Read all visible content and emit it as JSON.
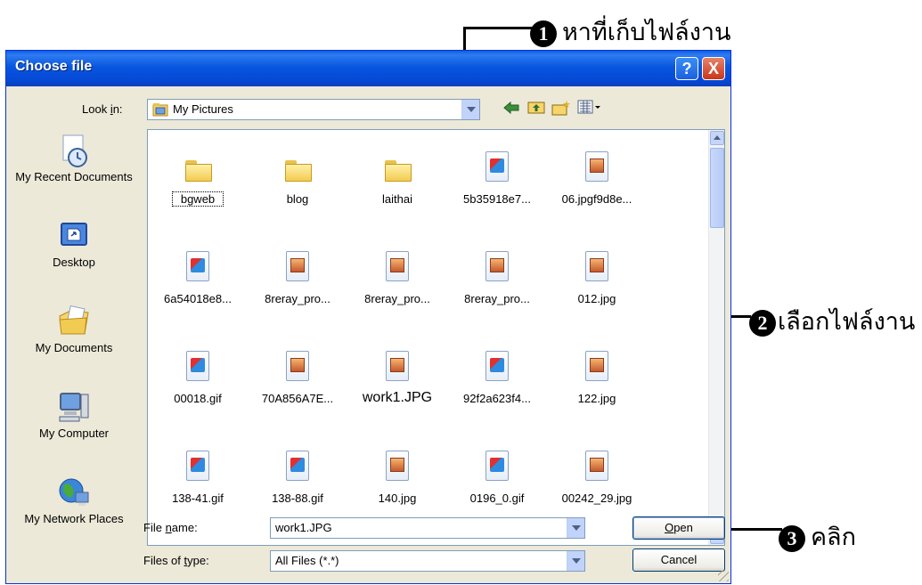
{
  "annotations": {
    "step1": {
      "number": "1",
      "text": "หาที่เก็บไฟล์งาน"
    },
    "step2": {
      "number": "2",
      "text": "เลือกไฟล์งาน"
    },
    "step3": {
      "number": "3",
      "text": "คลิก"
    }
  },
  "dialog": {
    "title": "Choose file",
    "help_icon": "?",
    "close_icon": "X",
    "look_in": {
      "label_pre": "Look ",
      "label_u": "i",
      "label_post": "n:",
      "value": "My Pictures"
    },
    "toolbar_icons": [
      "back-arrow-icon",
      "up-folder-icon",
      "new-folder-icon",
      "view-menu-icon"
    ],
    "places": [
      {
        "label": "My Recent Documents",
        "icon": "recent-documents-icon"
      },
      {
        "label": "Desktop",
        "icon": "desktop-icon"
      },
      {
        "label": "My Documents",
        "icon": "my-documents-icon"
      },
      {
        "label": "My Computer",
        "icon": "my-computer-icon"
      },
      {
        "label": "My Network Places",
        "icon": "network-places-icon"
      }
    ],
    "files": [
      {
        "name": "bgweb",
        "type": "folder"
      },
      {
        "name": "blog",
        "type": "folder"
      },
      {
        "name": "laithai",
        "type": "folder"
      },
      {
        "name": "5b35918e7...",
        "type": "gif"
      },
      {
        "name": "06.jpgf9d8e...",
        "type": "jpg"
      },
      {
        "name": "6a54018e8...",
        "type": "gif"
      },
      {
        "name": "8reray_pro...",
        "type": "jpg"
      },
      {
        "name": "8reray_pro...",
        "type": "jpg"
      },
      {
        "name": "8reray_pro...",
        "type": "jpg"
      },
      {
        "name": "012.jpg",
        "type": "jpg"
      },
      {
        "name": "00018.gif",
        "type": "gif"
      },
      {
        "name": "70A856A7E...",
        "type": "jpg"
      },
      {
        "name": "work1.JPG",
        "type": "jpg"
      },
      {
        "name": "92f2a623f4...",
        "type": "gif"
      },
      {
        "name": "122.jpg",
        "type": "jpg"
      },
      {
        "name": "138-41.gif",
        "type": "gif"
      },
      {
        "name": "138-88.gif",
        "type": "gif"
      },
      {
        "name": "140.jpg",
        "type": "jpg"
      },
      {
        "name": "0196_0.gif",
        "type": "gif"
      },
      {
        "name": "00242_29.jpg",
        "type": "jpg"
      }
    ],
    "file_name": {
      "label_pre": "File ",
      "label_u": "n",
      "label_post": "ame:",
      "value": "work1.JPG"
    },
    "files_of_type": {
      "label_pre": "Files of ",
      "label_u": "t",
      "label_post": "ype:",
      "value": "All Files (*.*)"
    },
    "open_button": {
      "u": "O",
      "rest": "pen"
    },
    "cancel_button": "Cancel"
  }
}
